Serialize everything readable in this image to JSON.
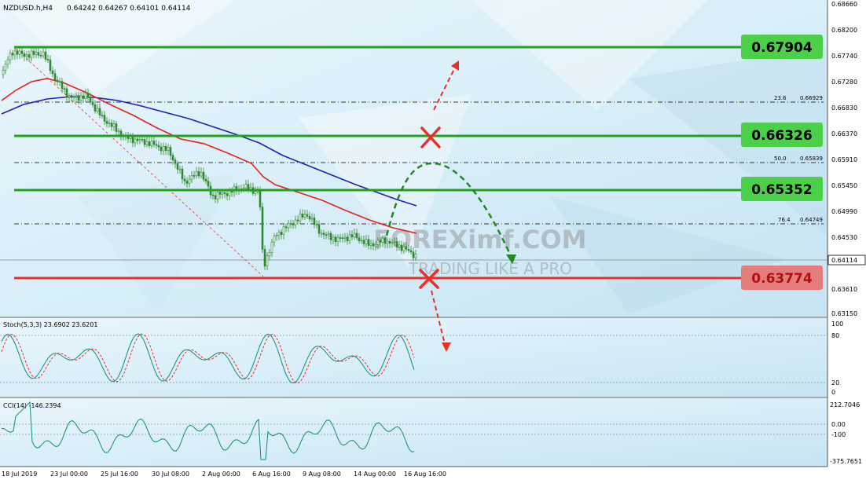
{
  "header": {
    "symbol": "NZDUSD.h,H4",
    "ohlc": "0.64242 0.64267 0.64101 0.64114"
  },
  "main": {
    "price_axis_labels": [
      "0.68660",
      "0.68200",
      "0.67740",
      "0.67280",
      "0.66830",
      "0.66370",
      "0.65910",
      "0.65450",
      "0.64990",
      "0.64530",
      "0.64114",
      "0.63610",
      "0.63150"
    ],
    "current_price": "0.64114",
    "fib_labels": [
      {
        "ratio": "23.6",
        "price": "0.66929"
      },
      {
        "ratio": "50.0",
        "price": "0.65839"
      },
      {
        "ratio": "76.4",
        "price": "0.64749"
      }
    ],
    "levels": [
      {
        "label": "0.67904",
        "kind": "resistance"
      },
      {
        "label": "0.66326",
        "kind": "resistance"
      },
      {
        "label": "0.65352",
        "kind": "resistance"
      },
      {
        "label": "0.63774",
        "kind": "support"
      }
    ],
    "watermark": {
      "brand": "FOREXimf.COM",
      "tagline": "TRADING LIKE A PRO"
    }
  },
  "stochastic": {
    "title": "Stoch(5,3,3) 23.6902 23.6201",
    "axis_labels": [
      "100",
      "80",
      "20",
      "0"
    ]
  },
  "cci": {
    "title": "CCI(14) -146.2394",
    "axis_labels": [
      "212.7046",
      "0.00",
      "-100",
      "-375.7651"
    ]
  },
  "time_axis": {
    "labels": [
      "18 Jul 2019",
      "23 Jul 00:00",
      "25 Jul 16:00",
      "30 Jul 08:00",
      "2 Aug 00:00",
      "6 Aug 16:00",
      "9 Aug 08:00",
      "14 Aug 00:00",
      "16 Aug 16:00"
    ]
  },
  "colors": {
    "background": "#e3f3fb",
    "green_level": "#22a21e",
    "red_level": "#e8302a",
    "label_green": "#4cd04a",
    "label_red": "#e67d7d",
    "ma_red": "#e2231a",
    "ma_blue": "#2020b8",
    "candles": "#2f8a30",
    "oscillator": "#0f8c7a"
  }
}
